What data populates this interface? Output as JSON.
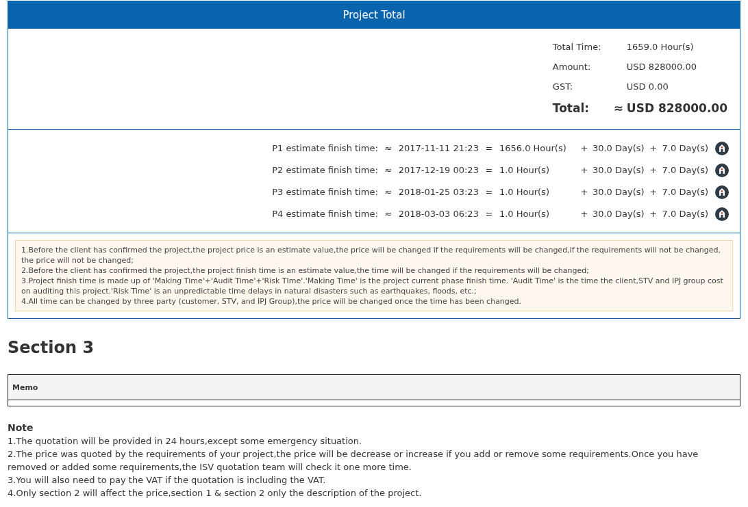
{
  "project_total": {
    "title": "Project Total",
    "totals": [
      {
        "kind": "plain",
        "label": "Total Time:",
        "value": "1659.0 Hour(s)"
      },
      {
        "kind": "plain",
        "label": "Amount:",
        "value": "USD 828000.00"
      },
      {
        "kind": "plain",
        "label": "GST:",
        "value": "USD 0.00"
      },
      {
        "kind": "grand",
        "label": "Total:",
        "approx": "≈",
        "value": "USD 828000.00"
      }
    ],
    "estimates": [
      {
        "label": "P1 estimate finish time:",
        "approx": "≈",
        "date": "2017-11-11 21:23",
        "equals": "=",
        "making": "1656.0 Hour(s)",
        "plus_1": "+",
        "audit": "30.0 Day(s)",
        "plus_2": "+",
        "risk": "7.0 Day(s)"
      },
      {
        "label": "P2 estimate finish time:",
        "approx": "≈",
        "date": "2017-12-19 00:23",
        "equals": "=",
        "making": "1.0 Hour(s)",
        "plus_1": "+",
        "audit": "30.0 Day(s)",
        "plus_2": "+",
        "risk": "7.0 Day(s)"
      },
      {
        "label": "P3 estimate finish time:",
        "approx": "≈",
        "date": "2018-01-25 03:23",
        "equals": "=",
        "making": "1.0 Hour(s)",
        "plus_1": "+",
        "audit": "30.0 Day(s)",
        "plus_2": "+",
        "risk": "7.0 Day(s)"
      },
      {
        "label": "P4 estimate finish time:",
        "approx": "≈",
        "date": "2018-03-03 06:23",
        "equals": "=",
        "making": "1.0 Hour(s)",
        "plus_1": "+",
        "audit": "30.0 Day(s)",
        "plus_2": "+",
        "risk": "7.0 Day(s)"
      }
    ],
    "notice": [
      "1.Before the client has confirmed the project,the project price is an estimate value,the price will be changed if the requirements will be changed,if the requirements will not be changed, the price will not be changed;",
      "2.Before the client has confirmed the project,the project finish time is an estimate value,the time will be changed if the requirements will be changed;",
      "3.Project finish time is made up of 'Making Time'+'Audit Time'+'Risk TIme'.'Making Time' is the project current phase finish time. 'Audit Time' is the time the client,STV and IPJ group cost on auditing this project.'Risk Time' is an unpredictable time delays in natural disasters such as earthquakes, floods, etc.;",
      "4.All time can be changed by three party (customer, STV, and IPJ Group),the price will be changed once the time has been changed."
    ]
  },
  "section_3": {
    "heading": "Section 3",
    "memo_table": {
      "columns": [
        "Memo"
      ]
    }
  },
  "note": {
    "title": "Note",
    "items": [
      "1.The quotation will be provided in 24 hours,except some emergency situation.",
      "2.The price was quoted by the requirements of your project,the price will be decrease or increase if you add or remove some requirements.Once you have removed or added some requirements,the ISV quotation team will check it one more time.",
      "3.You will also need to pay the VAT if the quotation is including the VAT.",
      "4.Only section 2 will affect the price,section 1 & section 2 only the description of the project."
    ]
  }
}
